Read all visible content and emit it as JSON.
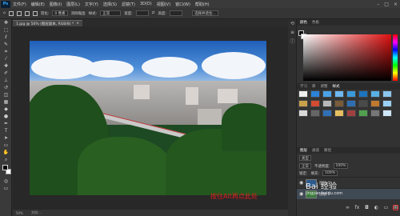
{
  "menubar": {
    "logo": "Ps",
    "items": [
      "文件(F)",
      "编辑(E)",
      "图像(I)",
      "图层(L)",
      "文字(Y)",
      "选择(S)",
      "滤镜(T)",
      "3D(D)",
      "视图(V)",
      "窗口(W)",
      "帮助(H)"
    ],
    "window_controls": [
      "–",
      "□",
      "×"
    ]
  },
  "options": {
    "feather_label": "羽化:",
    "feather_value": "0 像素",
    "antialias": "消除锯齿",
    "style_label": "样式:",
    "style_value": "正常",
    "width_label": "宽度:",
    "height_label": "高度:",
    "refine_button": "选择并遮住..."
  },
  "document": {
    "tab_label": "1.jpg @ 50% (图层副本, RGB/8) *",
    "status_zoom": "50%",
    "status_doc": "文档:..."
  },
  "annotation": "按住Alt再点此处",
  "panels": {
    "color_tabs": [
      "颜色",
      "色板"
    ],
    "swatch_tabs": [
      "学习",
      "库",
      "调整",
      "样式"
    ],
    "layer_tabs": [
      "图层",
      "通道",
      "路径"
    ],
    "layer_kind": "类型",
    "blend_mode": "正常",
    "opacity_label": "不透明度:",
    "opacity_value": "100%",
    "lock_label": "锁定:",
    "fill_label": "填充:",
    "fill_value": "100%",
    "layers": [
      "图层 1",
      "图层 0"
    ]
  },
  "watermark": {
    "text": "Bai 经验",
    "sub": "jingyan.baidu.com"
  },
  "colors": {
    "accent": "#31a8ff",
    "annotation": "#e02020"
  }
}
